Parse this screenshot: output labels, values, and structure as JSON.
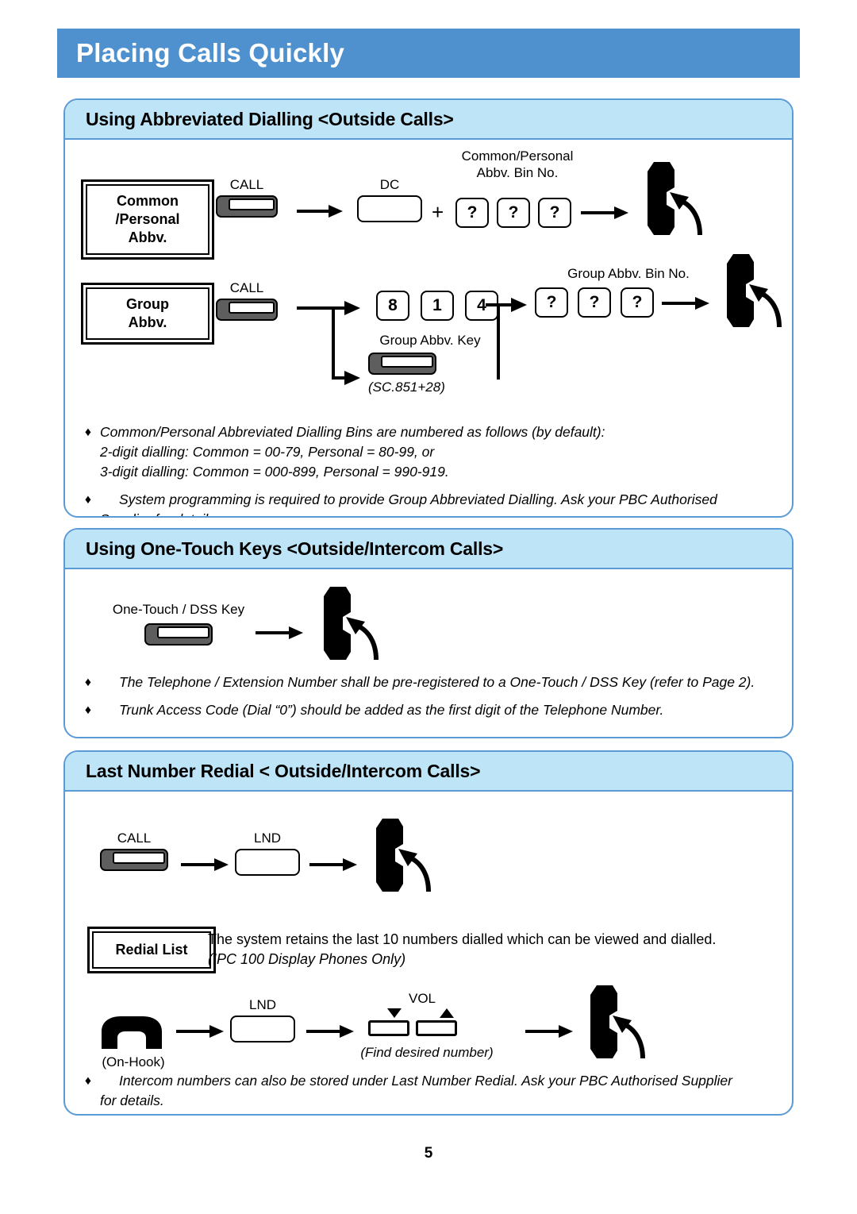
{
  "page": {
    "title": "Placing Calls Quickly",
    "page_number": "5",
    "header_color": "#4e91ce",
    "panel_header_color": "#bde4f7",
    "panel_border_color": "#5b9bd5"
  },
  "sections": [
    {
      "id": "abbreviated-dialling",
      "header": "Using Abbreviated Dialling <Outside Calls>",
      "flows": [
        {
          "id": "common-personal",
          "label_box": "Common\n/Personal\nAbbv.",
          "key_call_label": "CALL",
          "key_dc_label": "DC",
          "plus_sign": "+",
          "bin_caption": "Common/Personal\nAbbv. Bin No.",
          "bin_keys": [
            "?",
            "?",
            "?"
          ],
          "handset_icon": "handset-ringing-icon"
        },
        {
          "id": "group-abbv",
          "label_box": "Group\nAbbv.",
          "key_call_label": "CALL",
          "digit_keys": [
            "8",
            "1",
            "4"
          ],
          "group_key_caption": "Group Abbv. Key",
          "group_key_note": "(SC.851+28)",
          "bin_caption": "Group Abbv. Bin No.",
          "bin_keys": [
            "?",
            "?",
            "?"
          ],
          "handset_icon": "handset-ringing-icon"
        }
      ],
      "notes": [
        {
          "bullet": "♦",
          "indent": false,
          "lines": [
            "Common/Personal Abbreviated Dialling Bins are numbered as follows (by default):",
            "2-digit dialling: Common = 00-79, Personal = 80-99, or",
            "3-digit dialling: Common = 000-899, Personal = 990-919."
          ]
        },
        {
          "bullet": "♦",
          "indent": true,
          "lines": [
            "System programming is required to provide Group Abbreviated Dialling.    Ask your PBC Authorised",
            "Supplier for details."
          ]
        }
      ]
    },
    {
      "id": "one-touch-keys",
      "header": "Using One-Touch Keys <Outside/Intercom Calls>",
      "flows": [
        {
          "id": "one-touch",
          "key_caption": "One-Touch / DSS Key",
          "handset_icon": "handset-ringing-icon"
        }
      ],
      "notes": [
        {
          "bullet": "♦",
          "indent": true,
          "lines": [
            "The Telephone / Extension Number shall be pre-registered to a One-Touch / DSS Key (refer to Page 2)."
          ]
        },
        {
          "bullet": "♦",
          "indent": true,
          "lines": [
            "Trunk Access Code (Dial “0”) should be added as the first digit of the Telephone Number."
          ]
        }
      ]
    },
    {
      "id": "last-number-redial",
      "header": "Last Number Redial < Outside/Intercom Calls>",
      "flows": [
        {
          "id": "redial-offhook",
          "key_call_label": "CALL",
          "key_lnd_label": "LND",
          "handset_icon": "handset-ringing-icon"
        },
        {
          "id": "redial-list",
          "label_box": "Redial List",
          "description_line1": "The system retains the last 10 numbers dialled which can be viewed and dialled.",
          "description_line2": "(IPC 100 Display Phones Only)",
          "on_hook_caption": "(On-Hook)",
          "on_hook_icon": "handset-on-hook-icon",
          "key_lnd_label": "LND",
          "vol_label": "VOL",
          "vol_down_icon": "triangle-down-icon",
          "vol_up_icon": "triangle-up-icon",
          "vol_caption": "(Find desired number)",
          "handset_icon": "handset-ringing-icon"
        }
      ],
      "notes": [
        {
          "bullet": "♦",
          "indent": true,
          "lines": [
            "Intercom numbers can also be stored under Last Number Redial.    Ask your PBC Authorised Supplier",
            "for details."
          ]
        }
      ]
    }
  ]
}
